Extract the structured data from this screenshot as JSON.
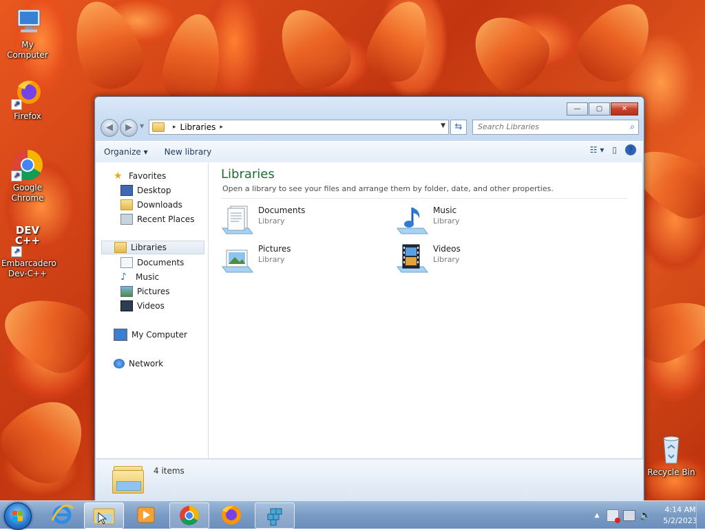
{
  "desktop": {
    "icons": [
      {
        "label": "My Computer",
        "icon": "computer-icon"
      },
      {
        "label": "Firefox",
        "icon": "firefox-icon"
      },
      {
        "label": "Google Chrome",
        "icon": "chrome-icon"
      },
      {
        "label": "Embarcadero Dev-C++",
        "icon": "devcpp-icon",
        "badge": "DEV C++"
      },
      {
        "label": "Recycle Bin",
        "icon": "recycle-bin-icon"
      }
    ]
  },
  "window": {
    "controls": {
      "minimize": "—",
      "maximize": "▢",
      "close": "✕"
    },
    "nav": {
      "back": "◀",
      "forward": "▶"
    },
    "address": {
      "crumb": "Libraries",
      "sep": "▸",
      "dropdown": "▼"
    },
    "refresh": "⇆",
    "search": {
      "placeholder": "Search Libraries"
    },
    "commandbar": {
      "organize": "Organize ▾",
      "new_library": "New library",
      "view": "☷ ▾",
      "pane": "▯",
      "help": "?"
    },
    "navpane": {
      "favorites": {
        "label": "Favorites",
        "items": [
          "Desktop",
          "Downloads",
          "Recent Places"
        ]
      },
      "libraries": {
        "label": "Libraries",
        "items": [
          "Documents",
          "Music",
          "Pictures",
          "Videos"
        ]
      },
      "computer": "My Computer",
      "network": "Network"
    },
    "content": {
      "title": "Libraries",
      "subtitle": "Open a library to see your files and arrange them by folder, date, and other properties.",
      "libraries": [
        {
          "name": "Documents",
          "type": "Library",
          "icon": "documents-library-icon"
        },
        {
          "name": "Music",
          "type": "Library",
          "icon": "music-library-icon"
        },
        {
          "name": "Pictures",
          "type": "Library",
          "icon": "pictures-library-icon"
        },
        {
          "name": "Videos",
          "type": "Library",
          "icon": "videos-library-icon"
        }
      ]
    },
    "details": {
      "count": "4 items"
    }
  },
  "taskbar": {
    "items": [
      "internet-explorer-icon",
      "windows-explorer-icon",
      "media-player-icon",
      "chrome-icon",
      "firefox-icon",
      "registry-editor-icon"
    ],
    "tray": {
      "chevron": "▲",
      "time": "4:14 AM",
      "date": "5/2/2023"
    }
  },
  "colors": {
    "title_green": "#1e6e2f",
    "taskbar": "#7a9bc4",
    "wallpaper": "#e04a18"
  }
}
